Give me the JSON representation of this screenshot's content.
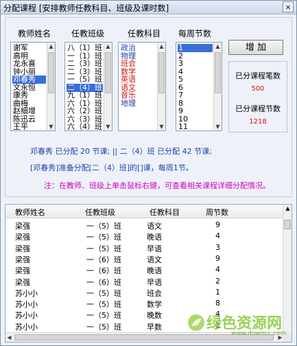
{
  "window": {
    "title": "分配课程 [安排教师任教科目、班级及课时数]",
    "close_glyph": "×"
  },
  "labels": {
    "teacher": "教师姓名",
    "class": "任教班级",
    "subject": "任教科目",
    "hours": "每周节数"
  },
  "teachers": [
    "谢军",
    "高明",
    "龙永喜",
    "钟小丽",
    "邓春秀",
    "文永恒",
    "康秀",
    "曲梅",
    "赵细增",
    "陈迅云",
    "王平"
  ],
  "teacher_selected": 4,
  "classes": [
    "八（1）班",
    "一（1）班",
    "二（3）班",
    "二（3）班",
    "一（5）班",
    "二（4）班",
    "九（1）班",
    "六（1）班",
    "六（2）班",
    "六（3）班",
    "六（4）班"
  ],
  "class_selected": 5,
  "subjects": [
    {
      "name": "政治",
      "color": "#1b3fb0"
    },
    {
      "name": "物理",
      "color": "#1b3fb0"
    },
    {
      "name": "班会",
      "color": "#d01010"
    },
    {
      "name": "数学",
      "color": "#d01010"
    },
    {
      "name": "英语",
      "color": "#d01010"
    },
    {
      "name": "语文",
      "color": "#d01010"
    },
    {
      "name": "音乐",
      "color": "#d01010"
    },
    {
      "name": "地理",
      "color": "#1b3fb0"
    }
  ],
  "hours": [
    "1",
    "2",
    "3",
    "4",
    "5",
    "6",
    "7",
    "8",
    "9",
    "10",
    "11"
  ],
  "hours_selected": 0,
  "buttons": {
    "add": "增 加"
  },
  "stats": {
    "count_label": "已分课程笔数",
    "count_value": "500",
    "hours_label": "已分课程节数",
    "hours_value": "1218"
  },
  "info": {
    "line1": "邓春秀 已分配 20 节课;   ||   二（4）班 已分配 42 节课;",
    "line2": "[邓春秀]准备分配[二（4）班]的[]课，每周1节。",
    "line3": "注：在教师、班级上单击鼠标右键，可查看相关课程详细分配情况。"
  },
  "table": {
    "headers": [
      "教师姓名",
      "任教班级",
      "任教科目",
      "周节数"
    ],
    "rows": [
      [
        "梁强",
        "一（5）班",
        "语文",
        "9"
      ],
      [
        "梁强",
        "一（5）班",
        "晚语",
        "4"
      ],
      [
        "梁强",
        "一（5）班",
        "早语",
        "3"
      ],
      [
        "梁强",
        "一（6）班",
        "语文",
        "9"
      ],
      [
        "梁强",
        "一（6）班",
        "晚语",
        "4"
      ],
      [
        "梁强",
        "一（6）班",
        "早语",
        "2"
      ],
      [
        "苏小小",
        "一（5）班",
        "班会",
        "1"
      ],
      [
        "苏小小",
        "一（5）班",
        "数学",
        "8"
      ],
      [
        "苏小小",
        "一（5）班",
        "晚数",
        "4"
      ],
      [
        "苏小小",
        "一（5）班",
        "早数",
        "2"
      ]
    ]
  },
  "watermark": {
    "main": "绿色资源网",
    "sub": "www.downcc.com"
  }
}
